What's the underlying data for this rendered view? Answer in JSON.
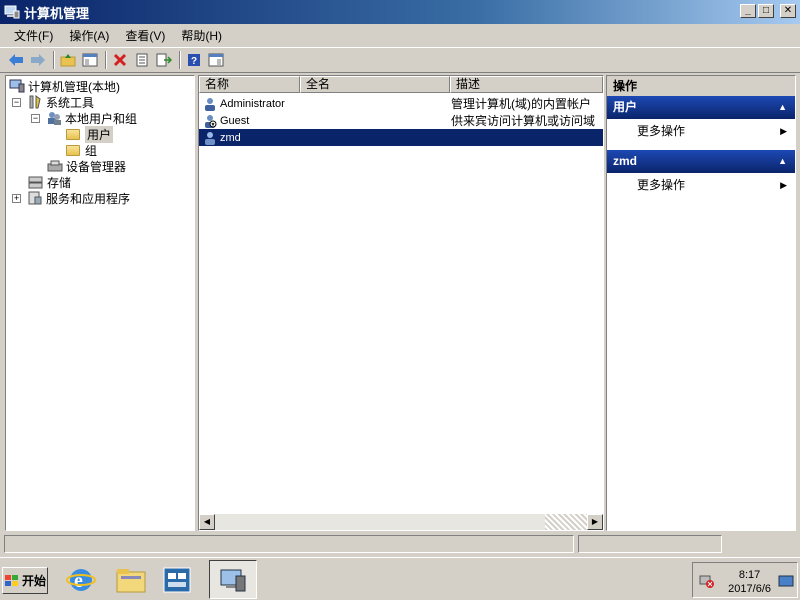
{
  "window": {
    "title": "计算机管理"
  },
  "menu": [
    "文件(F)",
    "操作(A)",
    "查看(V)",
    "帮助(H)"
  ],
  "tree": {
    "root": "计算机管理(本地)",
    "system_tools": "系统工具",
    "local_users": "本地用户和组",
    "users": "用户",
    "groups": "组",
    "device_manager": "设备管理器",
    "storage": "存储",
    "services": "服务和应用程序"
  },
  "list": {
    "columns": [
      "名称",
      "全名",
      "描述"
    ],
    "rows": [
      {
        "name": "Administrator",
        "full_name": "",
        "description": "管理计算机(域)的内置帐户"
      },
      {
        "name": "Guest",
        "full_name": "",
        "description": "供来宾访问计算机或访问域"
      },
      {
        "name": "zmd",
        "full_name": "",
        "description": ""
      }
    ],
    "selected_index": 2
  },
  "actions": {
    "header": "操作",
    "sections": [
      {
        "title": "用户",
        "item": "更多操作"
      },
      {
        "title": "zmd",
        "item": "更多操作"
      }
    ]
  },
  "taskbar": {
    "start_label": "开始",
    "time": "8:17",
    "date": "2017/6/6"
  },
  "colors": {
    "title_bar": "#0a246a",
    "selection": "#0a246a",
    "face": "#d4d0c8"
  }
}
